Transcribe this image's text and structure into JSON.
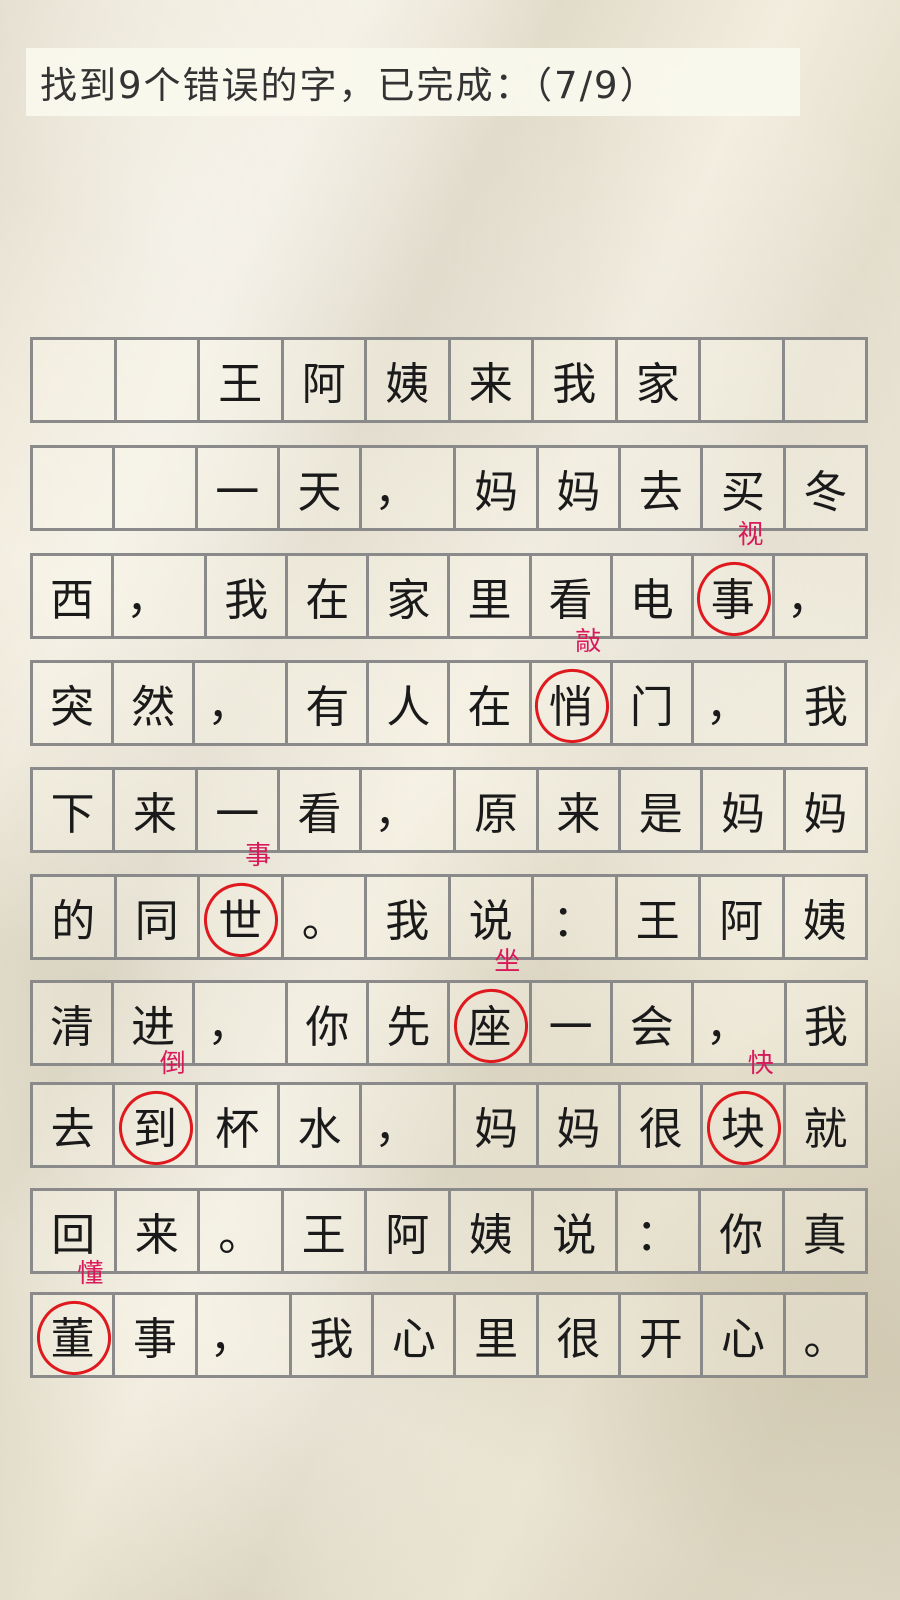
{
  "header": {
    "text": "找到9个错误的字，已完成：（7/9）"
  },
  "grid": {
    "rows": [
      [
        "",
        "",
        "王",
        "阿",
        "姨",
        "来",
        "我",
        "家",
        "",
        ""
      ],
      [
        "",
        "",
        "一",
        "天",
        "，",
        "妈",
        "妈",
        "去",
        "买",
        "冬"
      ],
      [
        "西",
        "，",
        "我",
        "在",
        "家",
        "里",
        "看",
        "电",
        "事",
        "，"
      ],
      [
        "突",
        "然",
        "，",
        "有",
        "人",
        "在",
        "悄",
        "门",
        "，",
        "我"
      ],
      [
        "下",
        "来",
        "一",
        "看",
        "，",
        "原",
        "来",
        "是",
        "妈",
        "妈"
      ],
      [
        "的",
        "同",
        "世",
        "。",
        "我",
        "说",
        "：",
        "王",
        "阿",
        "姨"
      ],
      [
        "清",
        "进",
        "，",
        "你",
        "先",
        "座",
        "一",
        "会",
        "，",
        "我"
      ],
      [
        "去",
        "到",
        "杯",
        "水",
        "，",
        "妈",
        "妈",
        "很",
        "块",
        "就"
      ],
      [
        "回",
        "来",
        "。",
        "王",
        "阿",
        "姨",
        "说",
        "：",
        "你",
        "真"
      ],
      [
        "董",
        "事",
        "，",
        "我",
        "心",
        "里",
        "很",
        "开",
        "心",
        "。"
      ]
    ],
    "found_errors": [
      {
        "row": 2,
        "col": 8,
        "correction": "视"
      },
      {
        "row": 3,
        "col": 6,
        "correction": "敲"
      },
      {
        "row": 5,
        "col": 2,
        "correction": "事"
      },
      {
        "row": 6,
        "col": 5,
        "correction": "坐"
      },
      {
        "row": 7,
        "col": 1,
        "correction": "倒"
      },
      {
        "row": 7,
        "col": 8,
        "correction": "快"
      },
      {
        "row": 9,
        "col": 0,
        "correction": "懂"
      }
    ]
  }
}
